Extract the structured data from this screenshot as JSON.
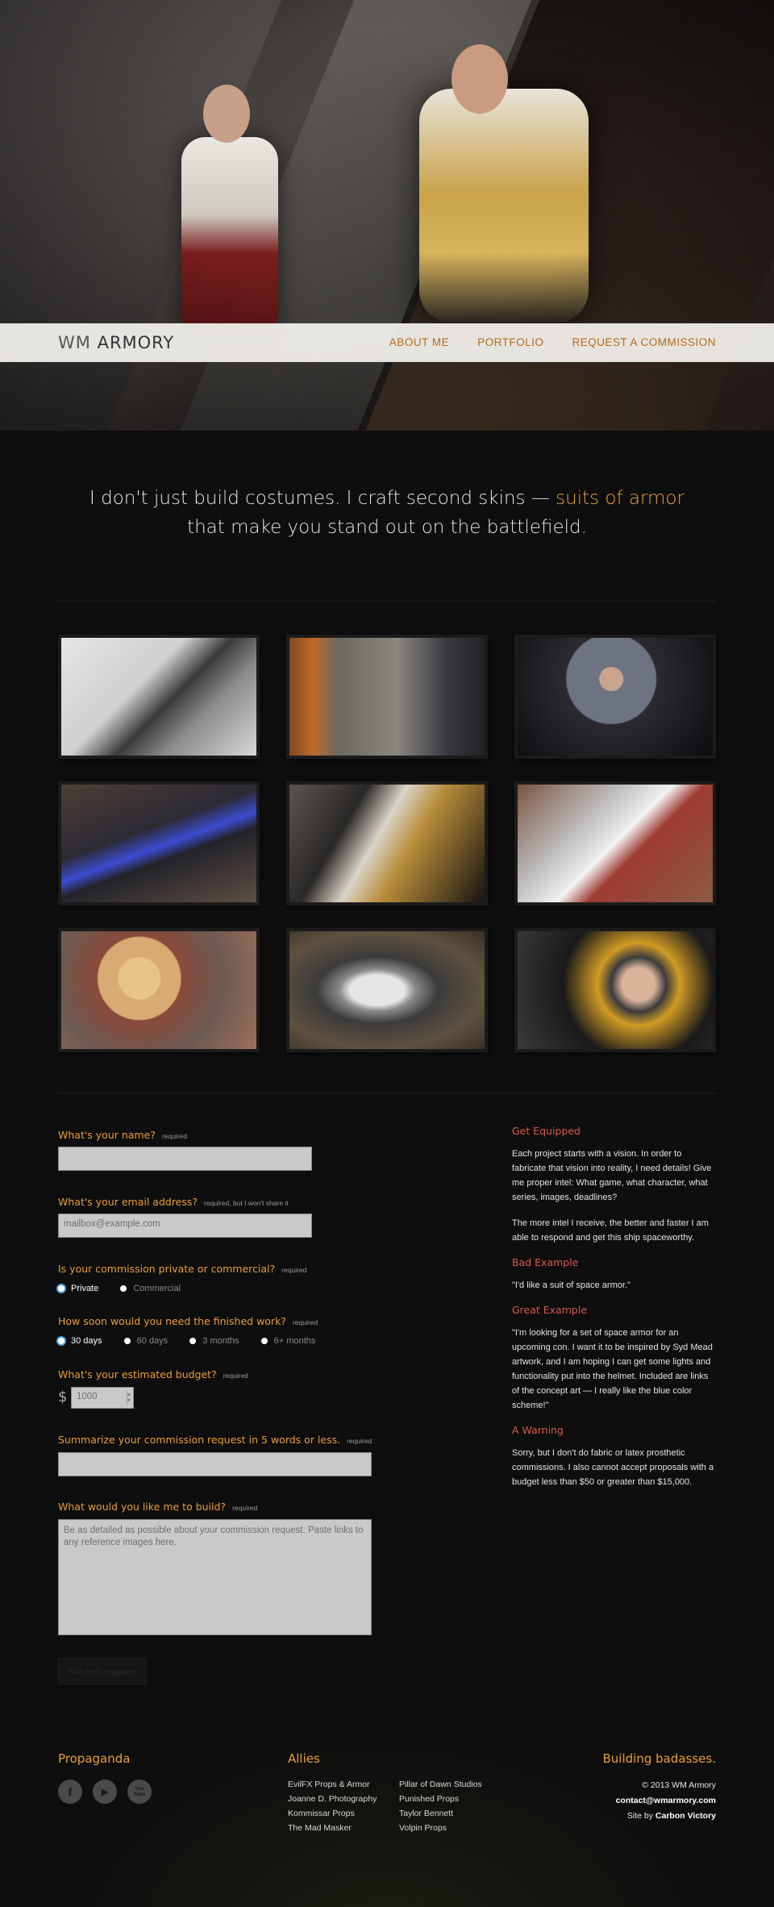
{
  "brand": {
    "logo_prefix": "WM",
    "logo_name": "ARMORY"
  },
  "nav": [
    {
      "label": "ABOUT ME"
    },
    {
      "label": "PORTFOLIO"
    },
    {
      "label": "REQUEST A COMMISSION"
    }
  ],
  "tagline": {
    "part1": "I don't just build costumes. I craft second skins — ",
    "highlight": "suits of armor",
    "part2": "that make you stand out on the battlefield."
  },
  "gallery": [
    {
      "name": "soldier-back"
    },
    {
      "name": "armor-plate-closeup"
    },
    {
      "name": "n7-armor-portrait"
    },
    {
      "name": "blue-lit-rifle"
    },
    {
      "name": "duo-action-shot"
    },
    {
      "name": "armored-gauntlet"
    },
    {
      "name": "blonde-portrait"
    },
    {
      "name": "pistol-prop"
    },
    {
      "name": "woman-with-rifle"
    }
  ],
  "form": {
    "name": {
      "question": "What's your name?",
      "required": "required",
      "value": ""
    },
    "email": {
      "question": "What's your email address?",
      "required": "required, but I won't share it",
      "placeholder": "mailbox@example.com"
    },
    "type": {
      "question": "Is your commission private or commercial?",
      "required": "required",
      "options": [
        "Private",
        "Commercial"
      ],
      "selected": "Private"
    },
    "timeline": {
      "question": "How soon would you need the finished work?",
      "required": "required",
      "options": [
        "30 days",
        "60 days",
        "3 months",
        "6+ months"
      ],
      "selected": "30 days"
    },
    "budget": {
      "question": "What's your estimated budget?",
      "required": "required",
      "currency": "$",
      "placeholder": "1000"
    },
    "summary": {
      "question": "Summarize your commission request in 5 words or less.",
      "required": "required",
      "value": ""
    },
    "details": {
      "question": "What would you like me to build?",
      "required": "required",
      "placeholder": "Be as detailed as possible about your commission request. Paste links to any reference images here."
    },
    "submit_label": "Submit request"
  },
  "sidebar": {
    "get_equipped": {
      "title": "Get Equipped",
      "p1": "Each project starts with a vision. In order to fabricate that vision into reality, I need details! Give me proper intel: What game, what character, what series, images, deadlines?",
      "p2": "The more intel I receive, the better and faster I am able to respond and get this ship spaceworthy."
    },
    "bad_example": {
      "title": "Bad Example",
      "text": "\"I'd like a suit of space armor.\""
    },
    "great_example": {
      "title": "Great Example",
      "text": "\"I'm looking for a set of space armor for an upcoming con. I want it to be inspired by Syd Mead artwork, and I am hoping I can get some lights and functionality put into the helmet. Included are links of the concept art — I really like the blue color scheme!\""
    },
    "warning": {
      "title": "A Warning",
      "text": "Sorry, but I don't do fabric or latex prosthetic commissions. I also cannot accept proposals with a budget less than $50 or greater than $15,000."
    }
  },
  "footer": {
    "propaganda": {
      "title": "Propaganda",
      "icons": [
        "f",
        "▶",
        "You Tube"
      ]
    },
    "allies": {
      "title": "Allies",
      "links": [
        "EvilFX Props & Armor",
        "Pillar of Dawn Studios",
        "Joanne D. Photography",
        "Punished Props",
        "Kommissar Props",
        "Taylor Bennett",
        "The Mad Masker",
        "Volpin Props"
      ]
    },
    "right": {
      "title": "Building badasses.",
      "copyright": "© 2013 WM Armory",
      "email": "contact@wmarmory.com",
      "site_by_prefix": "Site by",
      "site_by": "Carbon Victory"
    }
  },
  "colors": {
    "accent": "#e79e38",
    "warning_red": "#d95a4a",
    "background": "#0e0e0e"
  }
}
